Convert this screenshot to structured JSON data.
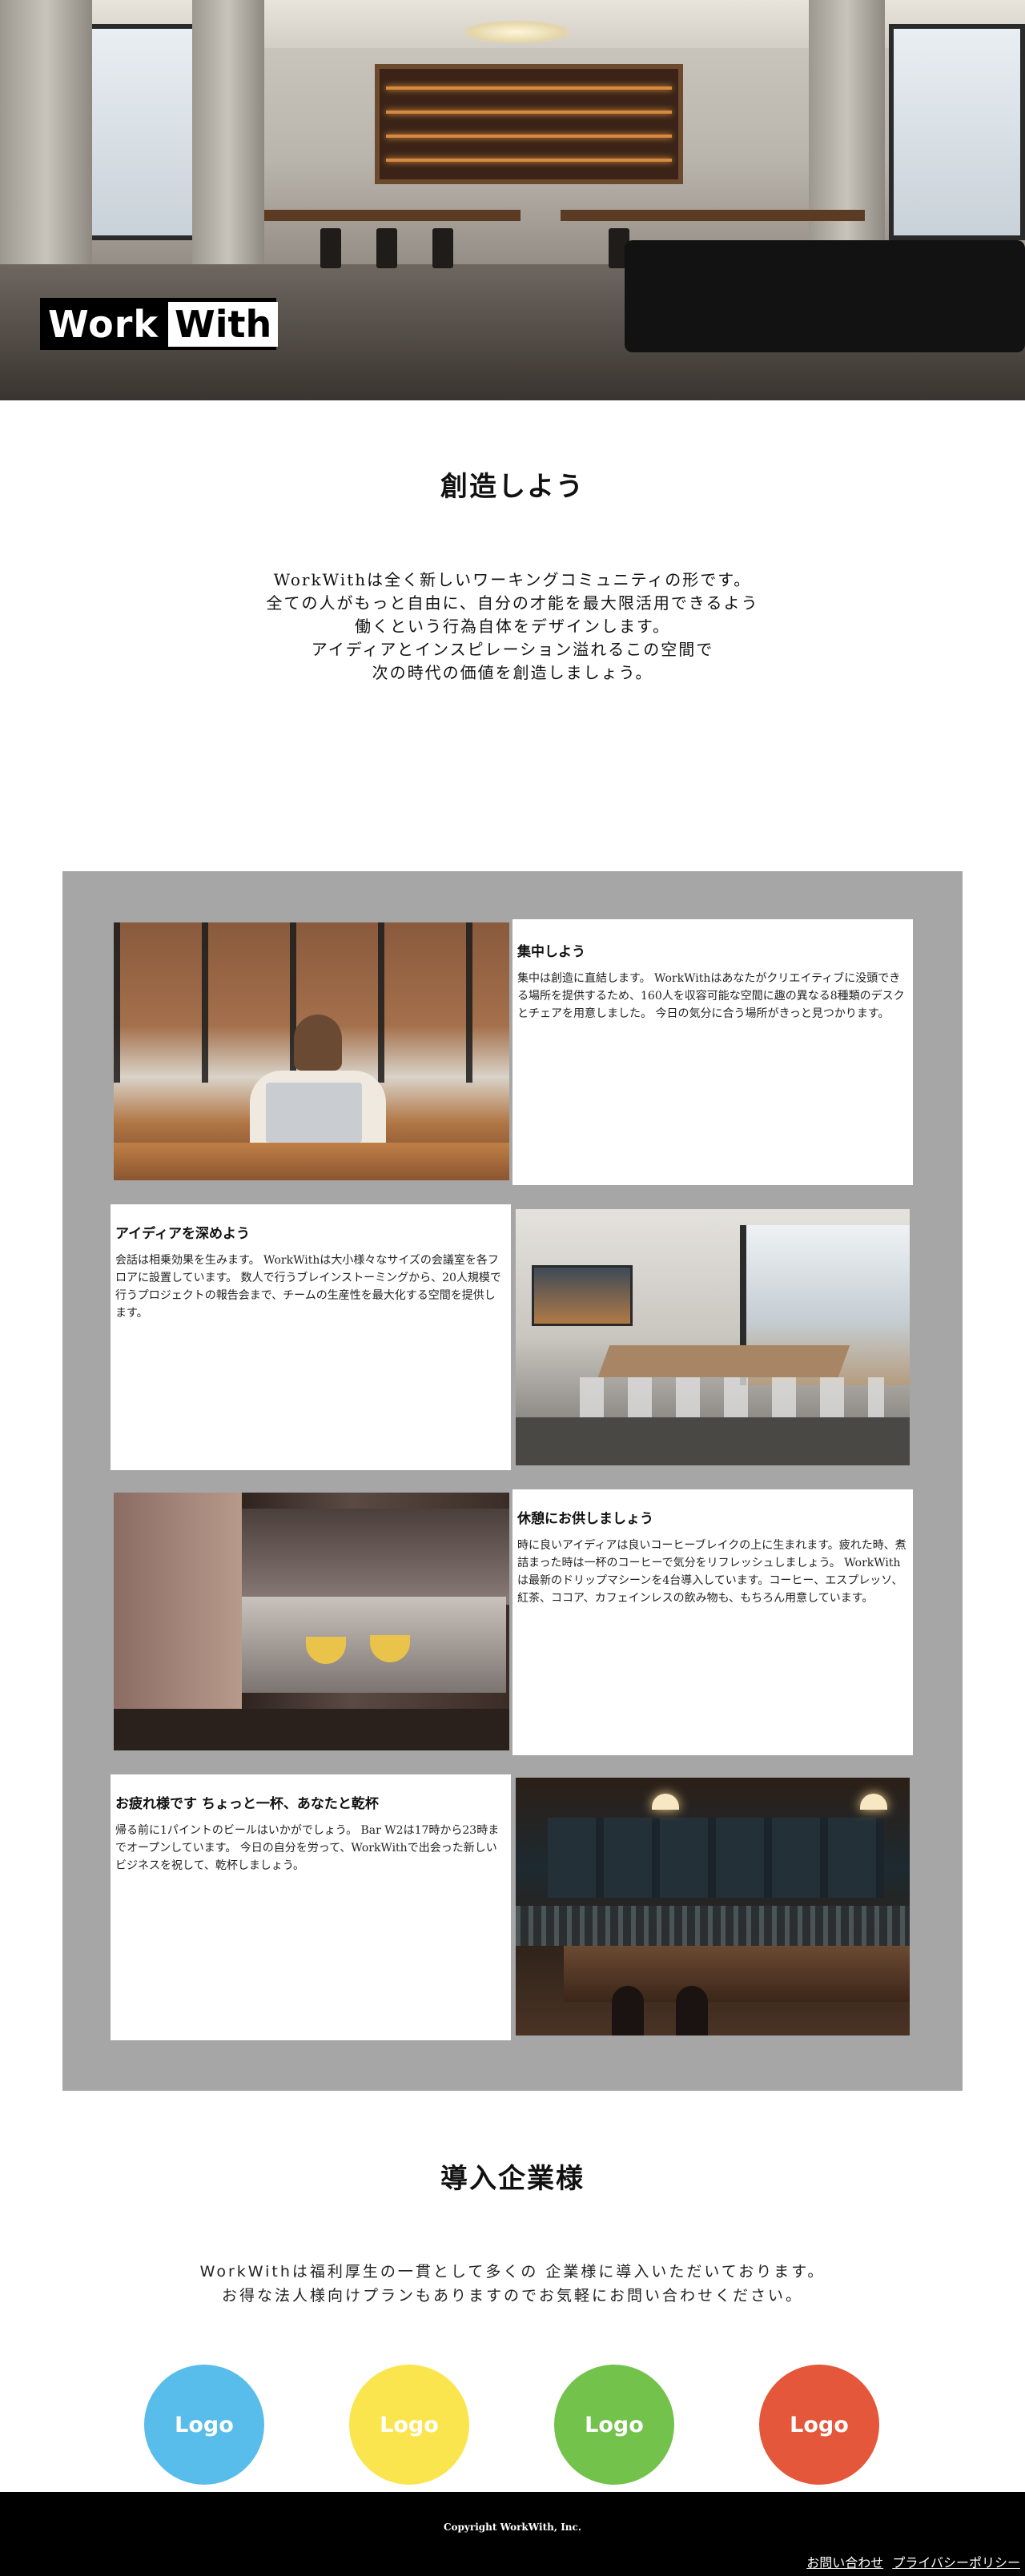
{
  "brand": {
    "logo_part1": "Work",
    "logo_part2": "With"
  },
  "intro": {
    "title": "創造しよう",
    "lines": [
      "WorkWithは全く新しいワーキングコミュニティの形です。",
      "全ての人がもっと自由に、自分の才能を最大限活用できるよう",
      "働くという行為自体をデザインします。",
      "アイディアとインスピレーション溢れるこの空間で",
      "次の時代の価値を創造しましょう。"
    ]
  },
  "features": [
    {
      "title": "集中しよう",
      "body": "集中は創造に直結します。 WorkWithはあなたがクリエイティブに没頭できる場所を提供するため、160人を収容可能な空間に趣の異なる8種類のデスクとチェアを用意しました。 今日の気分に合う場所がきっと見つかります。"
    },
    {
      "title": "アイディアを深めよう",
      "body": "会話は相乗効果を生みます。 WorkWithは大小様々なサイズの会議室を各フロアに設置しています。 数人で行うブレインストーミングから、20人規模で行うプロジェクトの報告会まで、チームの生産性を最大化する空間を提供します。"
    },
    {
      "title": "休憩にお供しましょう",
      "body": "時に良いアイディアは良いコーヒーブレイクの上に生まれます。疲れた時、煮詰まった時は一杯のコーヒーで気分をリフレッシュしましょう。 WorkWithは最新のドリップマシーンを4台導入しています。コーヒー、エスプレッソ、紅茶、ココア、カフェインレスの飲み物も、もちろん用意しています。"
    },
    {
      "title": "お疲れ様です ちょっと一杯、あなたと乾杯",
      "body": "帰る前に1パイントのビールはいかがでしょう。 Bar W2は17時から23時までオープンしています。 今日の自分を労って、WorkWithで出会った新しいビジネスを祝して、乾杯しましょう。"
    }
  ],
  "clients": {
    "title": "導入企業様",
    "lines": [
      "WorkWithは福利厚生の一貫として多くの 企業様に導入いただいております。",
      "お得な法人様向けプランもありますのでお気軽にお問い合わせください。"
    ],
    "logos": [
      {
        "label": "Logo",
        "color": "#58bdea"
      },
      {
        "label": "Logo",
        "color": "#fbe54e"
      },
      {
        "label": "Logo",
        "color": "#72c24c"
      },
      {
        "label": "Logo",
        "color": "#e5573a"
      }
    ]
  },
  "footer": {
    "copyright": "Copyright WorkWith, Inc.",
    "links": [
      "お問い合わせ",
      "プライバシーポリシー"
    ]
  }
}
